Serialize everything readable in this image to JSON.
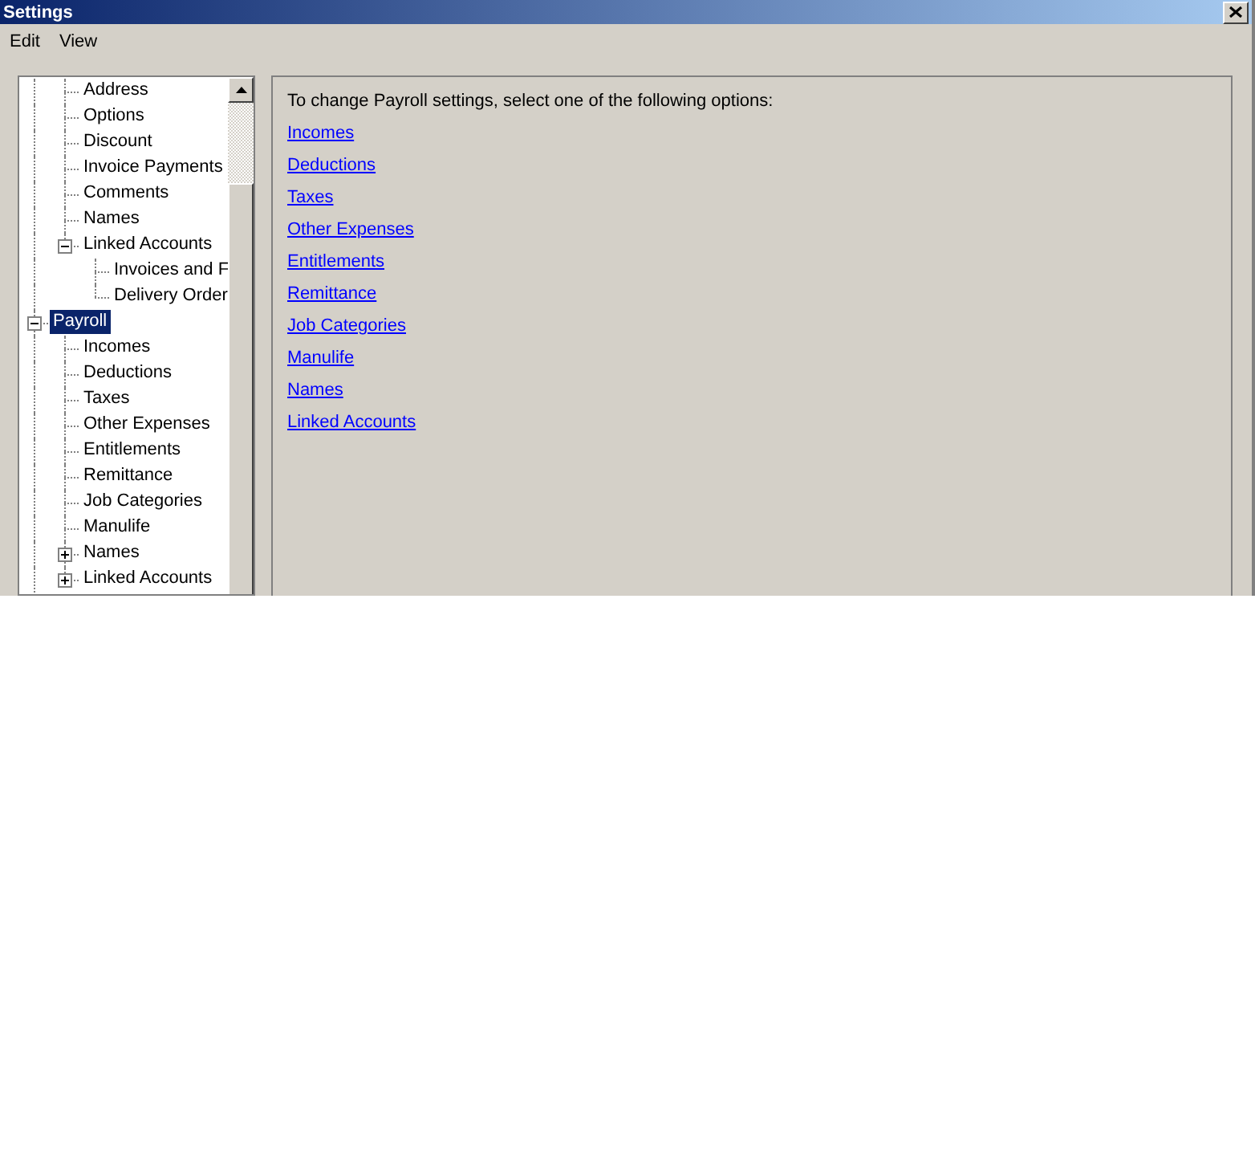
{
  "window": {
    "title": "Settings"
  },
  "menu": [
    {
      "label": "Edit"
    },
    {
      "label": "View"
    }
  ],
  "tree": {
    "items": [
      {
        "children": [
          {
            "label": "Address",
            "selected": false
          },
          {
            "label": "Options",
            "selected": false
          },
          {
            "label": "Discount",
            "selected": false
          },
          {
            "label": "Invoice Payments",
            "selected": false
          },
          {
            "label": "Comments",
            "selected": false
          },
          {
            "label": "Names",
            "selected": false
          },
          {
            "label": "Linked Accounts",
            "selected": false,
            "expanded": true,
            "children": [
              {
                "label": "Invoices and F",
                "selected": false
              },
              {
                "label": "Delivery Order",
                "selected": false
              }
            ]
          }
        ]
      },
      {
        "label": "Payroll",
        "selected": true,
        "expanded": true,
        "children": [
          {
            "label": "Incomes",
            "selected": false
          },
          {
            "label": "Deductions",
            "selected": false
          },
          {
            "label": "Taxes",
            "selected": false
          },
          {
            "label": "Other Expenses",
            "selected": false
          },
          {
            "label": "Entitlements",
            "selected": false
          },
          {
            "label": "Remittance",
            "selected": false
          },
          {
            "label": "Job Categories",
            "selected": false
          },
          {
            "label": "Manulife",
            "selected": false
          },
          {
            "label": "Names",
            "selected": false,
            "expanded": false
          },
          {
            "label": "Linked Accounts",
            "selected": false,
            "expanded": false
          }
        ]
      }
    ]
  },
  "content": {
    "intro": "To change Payroll settings, select one of the following options:",
    "links": [
      "Incomes",
      "Deductions",
      "Taxes",
      "Other Expenses",
      "Entitlements",
      "Remittance",
      "Job Categories",
      "Manulife",
      "Names",
      "Linked Accounts"
    ]
  }
}
